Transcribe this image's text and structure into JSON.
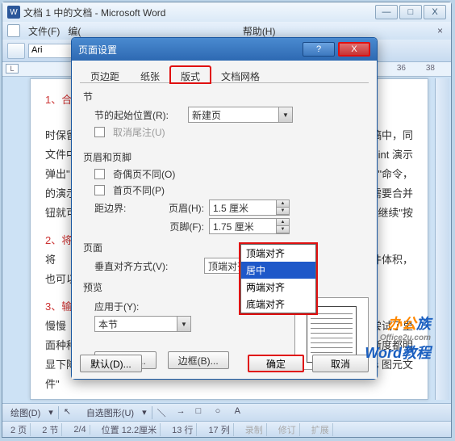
{
  "window": {
    "title": "文档 1 中的文档 - Microsoft Word",
    "btn_min": "—",
    "btn_max": "□",
    "btn_close": "X"
  },
  "menu": {
    "file": "文件(F)",
    "edit": "编(",
    "help": "帮助(H)"
  },
  "toolbar": {
    "font_name": "Ari"
  },
  "ruler": {
    "left_marker": "L",
    "n36": "36",
    "n38": "38"
  },
  "doc_lines": {
    "l1a": "1、合",
    "l2a": "时保留",
    "l2b": "文稿中，同",
    "l3a": "文件中",
    "l3b": "oint 演示",
    "l4a": "弹出\"",
    "l4b": "版\"命令，",
    "l5a": "的演示",
    "l5b": "需要合并",
    "l6a": "钮就可",
    "l6b": "继续\"按",
    "l7a": "2、将",
    "l8a": "将",
    "l8b": "文件体积，",
    "l9a": "也可以",
    "l10a": "3、输",
    "l11a": "慢慢",
    "l11b": "尝试了里",
    "l12a": "面种种",
    "l12b": "晰度都明",
    "l13a": "显下降",
    "l13b": "vs 图元文",
    "l14a": "件\""
  },
  "dialog": {
    "title": "页面设置",
    "help": "?",
    "close": "X",
    "tabs": {
      "margins": "页边距",
      "paper": "纸张",
      "layout": "版式",
      "grid": "文档网格"
    },
    "section": {
      "group": "节",
      "start_label": "节的起始位置(R):",
      "start_value": "新建页",
      "suppress_endnotes": "取消尾注(U)"
    },
    "headers": {
      "group": "页眉和页脚",
      "odd_even": "奇偶页不同(O)",
      "first_page": "首页不同(P)",
      "from_edge": "距边界:",
      "header_label": "页眉(H):",
      "header_value": "1.5 厘米",
      "footer_label": "页脚(F):",
      "footer_value": "1.75 厘米"
    },
    "page": {
      "group": "页面",
      "valign_label": "垂直对齐方式(V):",
      "valign_value": "顶端对齐",
      "options": {
        "top": "顶端对齐",
        "center": "居中",
        "justify": "两端对齐",
        "bottom": "底端对齐"
      }
    },
    "preview": {
      "group": "预览",
      "apply_label": "应用于(Y):",
      "apply_value": "本节"
    },
    "buttons": {
      "lines": "行号(N)...",
      "borders": "边框(B)...",
      "default": "默认(D)...",
      "ok": "确定",
      "cancel": "取消"
    }
  },
  "drawbar": {
    "draw": "绘图(D)",
    "autoshapes": "自选图形(U)"
  },
  "status": {
    "page": "2 页",
    "sec": "2 节",
    "pos": "2/4",
    "at": "位置 12.2厘米",
    "line": "13 行",
    "col": "17 列",
    "rec": "录制",
    "rev": "修订",
    "ext": "扩展"
  },
  "watermark": {
    "a": "办公",
    "b": "族",
    "url": "Office2u.com",
    "c": "Word教程"
  }
}
